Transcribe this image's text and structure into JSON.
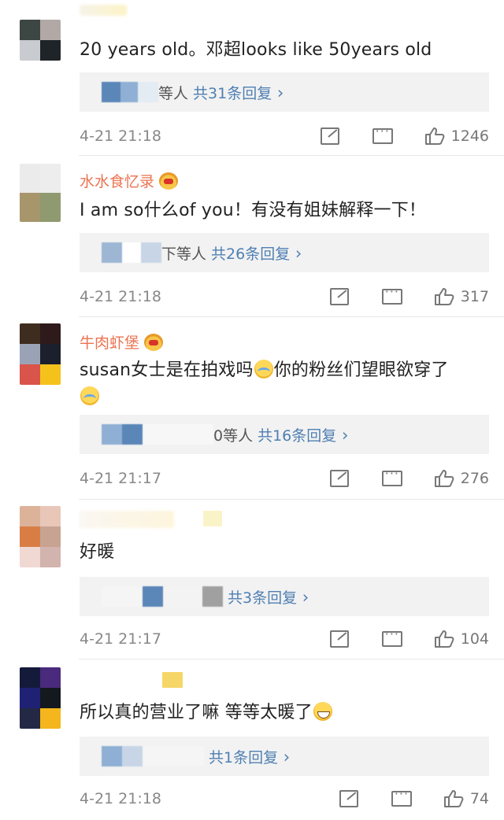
{
  "comments": [
    {
      "username": "",
      "text": "20 years old。邓超looks like 50years old",
      "reply_suffix": "等人",
      "reply_count": "共31条回复",
      "time": "4-21 21:18",
      "likes": "1246",
      "avatar_colors": [
        "#3c4744",
        "#b2a9a6",
        "#c8cbcf",
        "#1e2428"
      ]
    },
    {
      "username": "水水食忆录",
      "text": "I am so什么of you！有没有姐妹解释一下！",
      "reply_suffix": "下等人",
      "reply_count": "共26条回复",
      "time": "4-21 21:18",
      "likes": "317",
      "avatar_colors": [
        "#ebebeb",
        "#ededed",
        "#a7956c",
        "#8f9a70"
      ]
    },
    {
      "username": "牛肉虾堡",
      "text_before_emoji": "susan女士是在拍戏吗",
      "text_after_emoji": "你的粉丝们望眼欲穿了",
      "reply_suffix": "0等人",
      "reply_count": "共16条回复",
      "time": "4-21 21:17",
      "likes": "276",
      "avatar_colors": [
        "#3e2c1f",
        "#2e1a1a",
        "#9aa3b6",
        "#d9544a",
        "#f5c21b",
        "#1c1f2c"
      ]
    },
    {
      "username": "",
      "text": "好暖",
      "reply_count": "共3条回复",
      "time": "4-21 21:17",
      "likes": "104",
      "avatar_colors": [
        "#dcb399",
        "#e8c7b9",
        "#d87e45",
        "#c8a392",
        "#f0d8d3",
        "#d3b3ad"
      ]
    },
    {
      "username": "",
      "text": "所以真的营业了嘛 等等太暖了",
      "reply_count": "共1条回复",
      "time": "4-21 21:18",
      "likes": "74",
      "avatar_colors": [
        "#141a3a",
        "#4a2a7c",
        "#1f2274",
        "#14181f",
        "#232845",
        "#f5b51c"
      ]
    }
  ],
  "colors": {
    "username": "#eb7350",
    "reply_link": "#4f7fb3",
    "meta": "#888888",
    "reply_bg": "#f2f2f2"
  },
  "icons": [
    "share-icon",
    "comment-icon",
    "like-icon"
  ]
}
